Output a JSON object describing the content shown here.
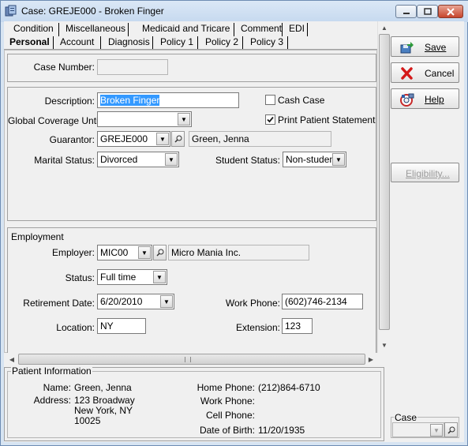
{
  "window": {
    "title": "Case: GREJE000 - Broken Finger"
  },
  "tabs": {
    "row1": [
      {
        "label": "Condition"
      },
      {
        "label": "Miscellaneous"
      },
      {
        "label": "Medicaid and Tricare"
      },
      {
        "label": "Comment"
      },
      {
        "label": "EDI"
      }
    ],
    "row2": [
      {
        "label": "Personal",
        "active": true
      },
      {
        "label": "Account"
      },
      {
        "label": "Diagnosis"
      },
      {
        "label": "Policy 1"
      },
      {
        "label": "Policy 2"
      },
      {
        "label": "Policy 3"
      }
    ]
  },
  "case_number": {
    "label": "Case Number:",
    "value": ""
  },
  "personal": {
    "description_label": "Description:",
    "description_value": "Broken Finger",
    "cash_case_label": "Cash Case",
    "cash_case_checked": false,
    "global_coverage_label": "Global Coverage Until:",
    "global_coverage_value": "",
    "print_statement_label": "Print Patient Statement",
    "print_statement_checked": true,
    "guarantor_label": "Guarantor:",
    "guarantor_code": "GREJE000",
    "guarantor_name": "Green, Jenna",
    "marital_label": "Marital Status:",
    "marital_value": "Divorced",
    "student_label": "Student Status:",
    "student_value": "Non-student"
  },
  "employment": {
    "section_label": "Employment",
    "employer_label": "Employer:",
    "employer_code": "MIC00",
    "employer_name": "Micro Mania Inc.",
    "status_label": "Status:",
    "status_value": "Full time",
    "retirement_label": "Retirement Date:",
    "retirement_value": "6/20/2010",
    "work_phone_label": "Work Phone:",
    "work_phone_value": "(602)746-2134",
    "location_label": "Location:",
    "location_value": "NY",
    "extension_label": "Extension:",
    "extension_value": "123"
  },
  "patient_info": {
    "section_label": "Patient Information",
    "name_label": "Name:",
    "name_value": "Green, Jenna",
    "address_label": "Address:",
    "address_line1": "123 Broadway",
    "address_line2": "New York, NY",
    "address_line3": "10025",
    "home_phone_label": "Home Phone:",
    "home_phone_value": "(212)864-6710",
    "work_phone_label": "Work Phone:",
    "work_phone_value": "",
    "cell_phone_label": "Cell Phone:",
    "cell_phone_value": "",
    "dob_label": "Date of Birth:",
    "dob_value": "11/20/1935"
  },
  "buttons": {
    "save": "Save",
    "cancel": "Cancel",
    "help": "Help",
    "eligibility": "Eligibility..."
  },
  "case_box": {
    "label": "Case",
    "value": ""
  },
  "colors": {
    "selection": "#3399ff",
    "titlebar": "#c6d9ef",
    "close_button": "#c7452c"
  }
}
